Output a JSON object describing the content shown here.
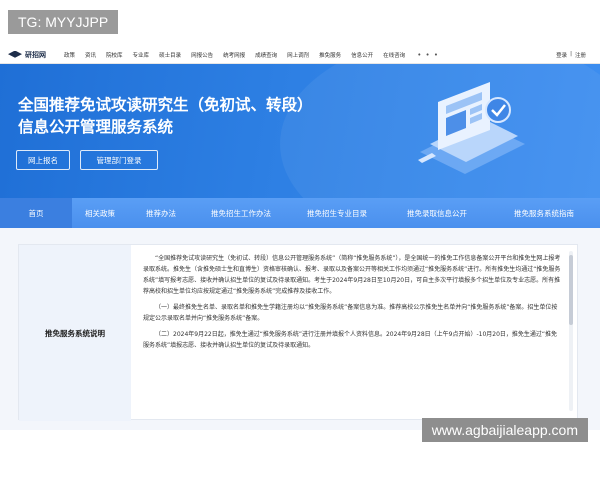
{
  "watermark_tl": "TG: MYYJJPP",
  "watermark_br": "www.agbaijialeapp.com",
  "topnav": {
    "logo": "研招网",
    "items": [
      "政策",
      "资讯",
      "院校库",
      "专业库",
      "硕士目录",
      "网报公告",
      "统考网报",
      "成绩查询",
      "网上调剂",
      "推免服务",
      "信息公开",
      "在线咨询"
    ],
    "more": "• • •",
    "login": "登录",
    "sep": "|",
    "register": "注册"
  },
  "banner": {
    "title_line1": "全国推荐免试攻读研究生（免初试、转段）",
    "title_line2": "信息公开管理服务系统",
    "btn_apply": "网上报名",
    "btn_admin": "管理部门登录"
  },
  "subnav": {
    "items": [
      "首页",
      "相关政策",
      "推荐办法",
      "推免招生工作办法",
      "推免招生专业目录",
      "推免录取信息公开",
      "推免服务系统指南"
    ]
  },
  "content": {
    "side_title": "推免服务系统说明",
    "paragraphs": [
      "“全国推荐免试攻读研究生（免初试、转段）信息公开管理服务系统”（简称“推免服务系统”），是全国统一的推免工作信息备案公开平台和推免生网上报考录取系统。推免生（含推免硕士生和直博生）资格审核确认、报考、录取以及备案公开等相关工作均须通过“推免服务系统”进行。所有推免生均通过“推免服务系统”填写报考志愿、接收并确认招生单位的复试及待录取通知。考生于2024年9月28日至10月20日，可自主多次平行填报多个招生单位及专业志愿。所有推荐高校和招生单位均应按规定通过“推免服务系统”完成推荐及接收工作。",
      "（一）最终推免生名单、录取名单和推免生学籍注册均以“推免服务系统”备案信息为准。推荐高校公示推免生名单并向“推免服务系统”备案。招生单位按规定公示录取名单并向“推免服务系统”备案。",
      "（二）2024年9月22日起，推免生通过“推免服务系统”进行注册并填报个人资料信息。2024年9月28日（上午9点开始）-10月20日，推免生通过“推免服务系统”填报志愿、接收并确认招生单位的复试及待录取通知。"
    ]
  },
  "colors": {
    "banner": "#2d7fe3",
    "subnav": "#4a90ee",
    "active": "#3b7fe0"
  }
}
